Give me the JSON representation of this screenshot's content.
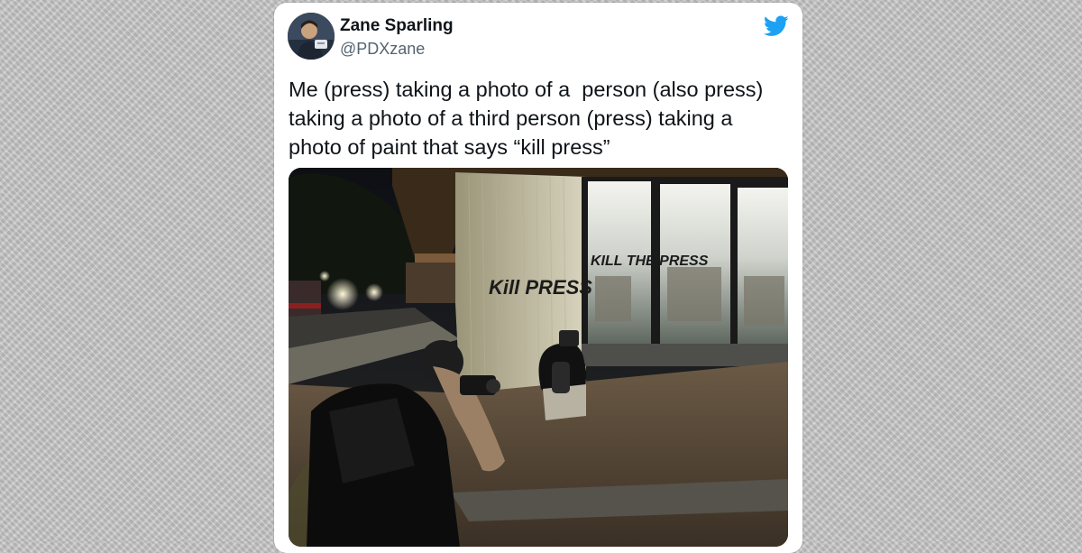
{
  "tweet": {
    "author": {
      "name": "Zane Sparling",
      "handle": "@PDXzane"
    },
    "text": "Me (press) taking a photo of a  person (also press) taking a photo of a third person (press) taking a photo of paint that says “kill press”",
    "media": {
      "graffiti_wall": "Kill PRESS",
      "graffiti_window": "KILL THE PRESS"
    },
    "brand_icon": "twitter-bird-icon",
    "colors": {
      "brand": "#1da1f2",
      "text": "#0f1419",
      "secondary": "#536471",
      "card": "#ffffff"
    }
  }
}
